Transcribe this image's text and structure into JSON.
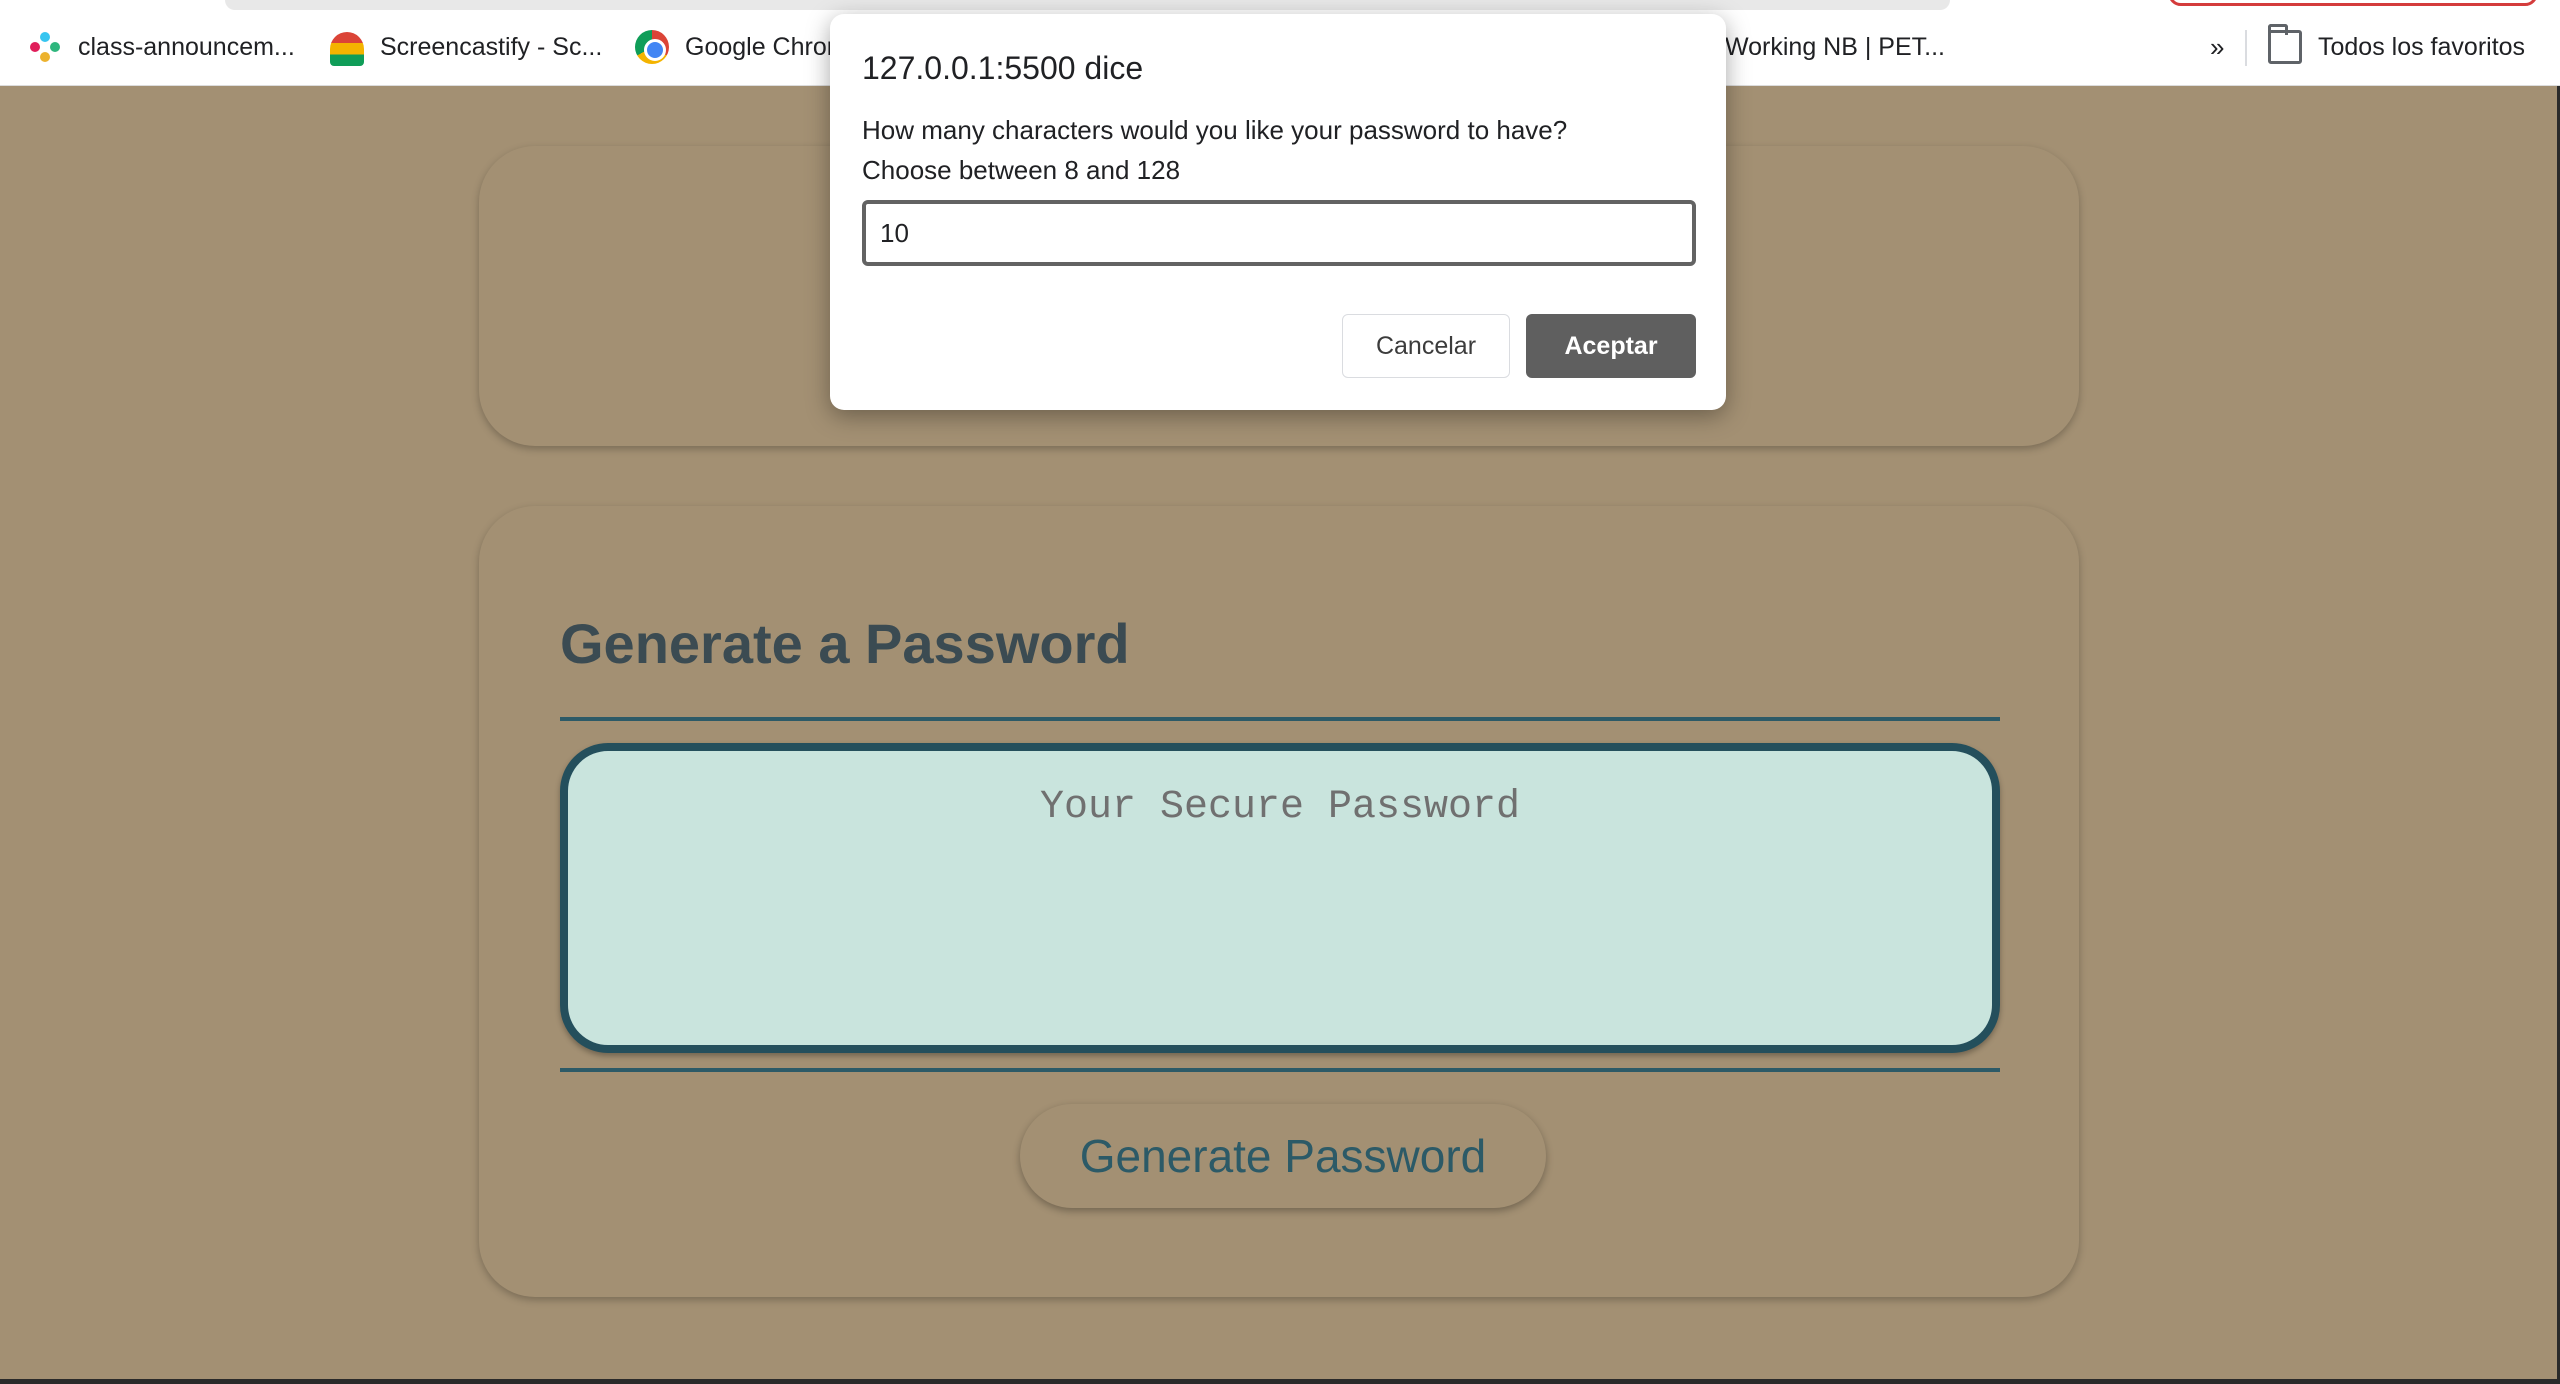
{
  "bookmarks": {
    "items": [
      {
        "label": "class-announcem...",
        "icon": "slack-icon"
      },
      {
        "label": "Screencastify - Sc...",
        "icon": "screencastify-icon"
      },
      {
        "label": "Google Chror",
        "icon": "chrome-icon"
      },
      {
        "label": "Working NB | PET...",
        "icon": "bookmark-icon"
      }
    ],
    "overflow_label": "»",
    "all_bookmarks_label": "Todos los favoritos"
  },
  "page": {
    "heading": "Generate a Password",
    "password_placeholder": "Your Secure Password",
    "generate_button": "Generate Password"
  },
  "dialog": {
    "origin": "127.0.0.1:5500 dice",
    "message_line1": "How many characters would you like your password to have?",
    "message_line2": "Choose between 8 and 128",
    "input_value": "10",
    "cancel_label": "Cancelar",
    "ok_label": "Aceptar"
  },
  "colors": {
    "page_background": "#a39073",
    "accent": "#2c5a67",
    "password_box": "#c9e4dd"
  }
}
